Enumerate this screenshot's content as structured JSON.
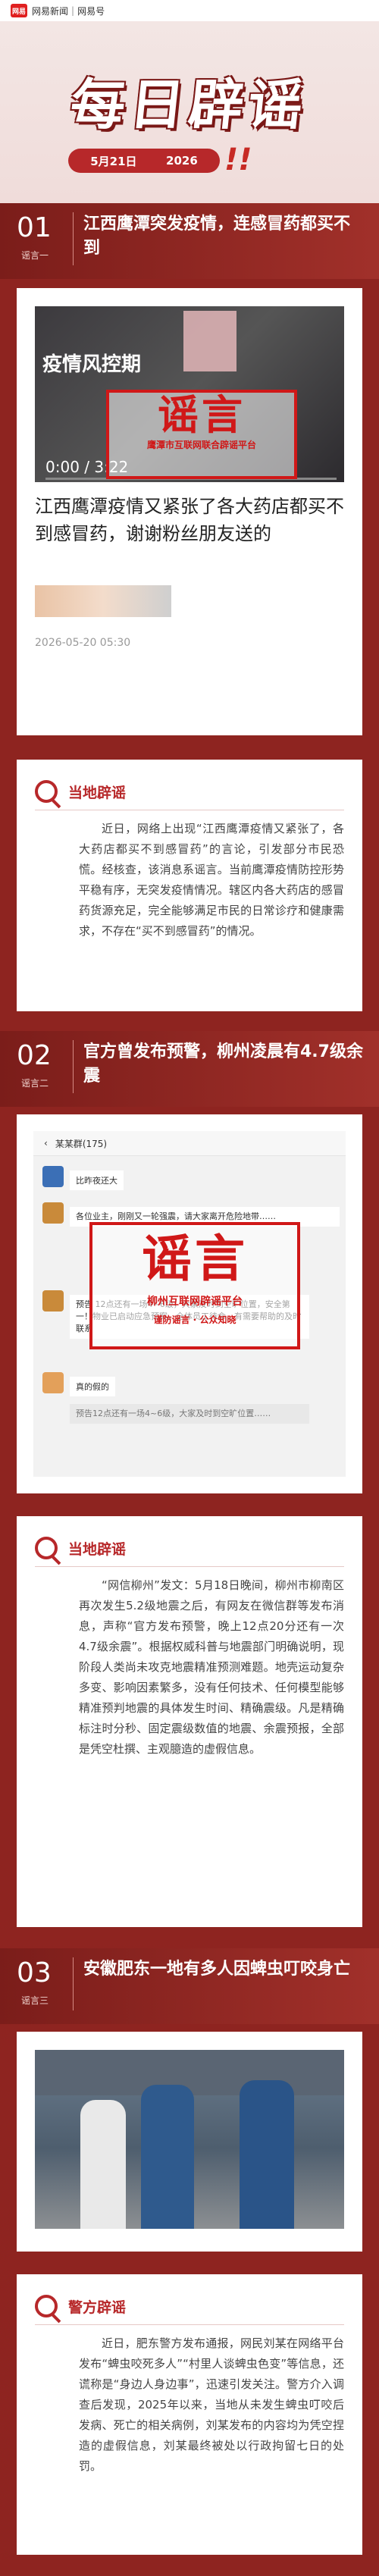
{
  "topbar": {
    "brand1": "网易新闻",
    "sep": "|",
    "brand2": "网易号",
    "logo": "网易"
  },
  "hero": {
    "title": "每日辟谣",
    "date": "5月21日",
    "year": "2026",
    "bang": "!!"
  },
  "sections": [
    {
      "num": "01",
      "tag": "谣言一",
      "title": "江西鹰潭突发疫情，连感冒药都买不到",
      "image_caption": "疫情风控期",
      "video_time": "0:00 / 3:22",
      "stamp_main": "谣言",
      "stamp_sub": "鹰潭市互联网联合辟谣平台",
      "news_title": "江西鹰潭疫情又紧张了各大药店都买不到感冒药，谢谢粉丝朋友送的",
      "news_date": "2026-05-20 05:30",
      "debunk_title": "当地辟谣",
      "debunk_text": "近日，网络上出现“江西鹰潭疫情又紧张了，各大药店都买不到感冒药”的言论，引发部分市民恐慌。经核查，该消息系谣言。当前鹰潭疫情防控形势平稳有序，无突发疫情情况。辖区内各大药店的感冒药货源充足，完全能够满足市民的日常诊疗和健康需求，不存在“买不到感冒药”的情况。"
    },
    {
      "num": "02",
      "tag": "谣言二",
      "title": "官方曾发布预警，柳州凌晨有4.7级余震",
      "chat_title": "某某群(175)",
      "chat_msgs": [
        "比昨夜还大",
        "各位业主，刚刚又一轮强震，请大家离开危险地带……",
        "预告 12点还有一场4~6级，大家及时到空旷位置，安全第一！物业已启动应急预案，全体员工待命，有需要帮助的及时联系",
        "真的假的",
        "预告12点还有一场4~6级，大家及时到空旷位置……"
      ],
      "stamp_main": "谣言",
      "stamp_sub": "柳州互联网辟谣平台",
      "stamp_sub2": "谨防谣言 · 公众知晓",
      "debunk_title": "当地辟谣",
      "debunk_text": "“网信柳州”发文：5月18日晚间，柳州市柳南区再次发生5.2级地震之后，有网友在微信群等发布消息，声称“官方发布预警，晚上12点20分还有一次4.7级余震”。根据权威科普与地震部门明确说明，现阶段人类尚未攻克地震精准预测难题。地壳运动复杂多变、影响因素繁多，没有任何技术、任何模型能够精准预判地震的具体发生时间、精确震级。凡是精确标注时分秒、固定震级数值的地震、余震预报，全部是凭空杜撰、主观臆造的虚假信息。"
    },
    {
      "num": "03",
      "tag": "谣言三",
      "title": "安徽肥东一地有多人因蜱虫叮咬身亡",
      "debunk_title": "警方辟谣",
      "debunk_text": "近日，肥东警方发布通报，网民刘某在网络平台发布“蜱虫咬死多人”“村里人谈蜱虫色变”等信息，还谎称是“身边人身边事”，迅速引发关注。警方介入调查后发现，2025年以来，当地从未发生蜱虫叮咬后发病、死亡的相关病例，刘某发布的内容均为凭空捏造的虚假信息，刘某最终被处以行政拘留七日的处罚。"
    }
  ],
  "colors": {
    "accent": "#b7282a",
    "bg": "#8e2420",
    "stamp": "#d01818"
  }
}
